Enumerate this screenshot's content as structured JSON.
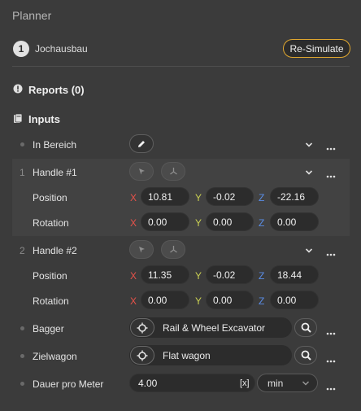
{
  "panel": {
    "title": "Planner"
  },
  "step": {
    "number": "1",
    "label": "Jochausbau"
  },
  "resimulate_label": "Re-Simulate",
  "reports": {
    "label": "Reports (0)"
  },
  "inputs": {
    "label": "Inputs"
  },
  "in_bereich": {
    "label": "In Bereich"
  },
  "handle1": {
    "num": "1",
    "label": "Handle #1",
    "position_label": "Position",
    "rotation_label": "Rotation",
    "pos": {
      "x": "10.81",
      "y": "-0.02",
      "z": "-22.16"
    },
    "rot": {
      "x": "0.00",
      "y": "0.00",
      "z": "0.00"
    }
  },
  "handle2": {
    "num": "2",
    "label": "Handle #2",
    "position_label": "Position",
    "rotation_label": "Rotation",
    "pos": {
      "x": "11.35",
      "y": "-0.02",
      "z": "18.44"
    },
    "rot": {
      "x": "0.00",
      "y": "0.00",
      "z": "0.00"
    }
  },
  "axes": {
    "x": "X",
    "y": "Y",
    "z": "Z"
  },
  "bagger": {
    "label": "Bagger",
    "value": "Rail & Wheel Excavator"
  },
  "zielwagon": {
    "label": "Zielwagon",
    "value": "Flat wagon"
  },
  "dauer": {
    "label": "Dauer pro Meter",
    "value": "4.00",
    "clear": "[x]",
    "unit": "min"
  },
  "colors": {
    "accent": "#e0a72f",
    "x_axis": "#e8524a",
    "y_axis": "#c9cf52",
    "z_axis": "#5a8de6"
  }
}
